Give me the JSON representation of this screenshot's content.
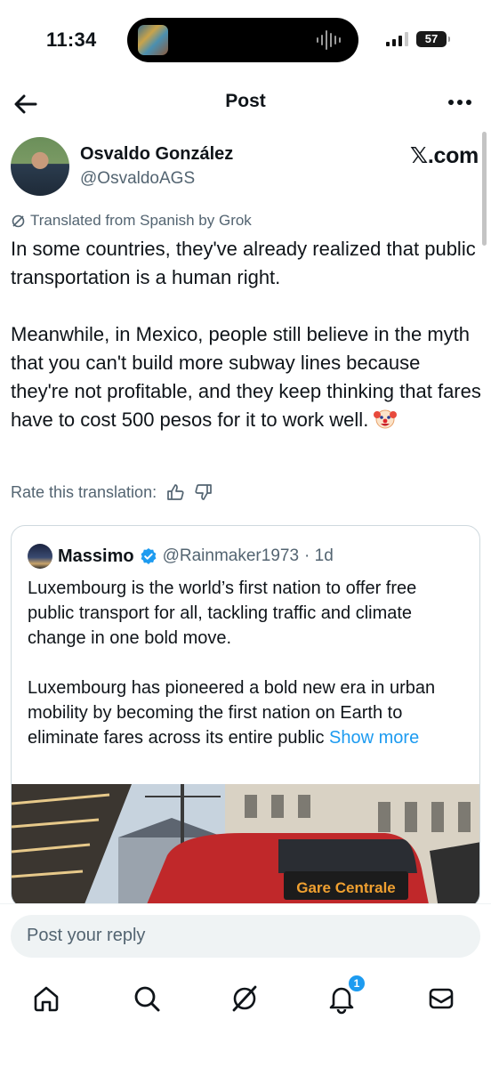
{
  "status": {
    "time": "11:34",
    "battery": "57"
  },
  "header": {
    "title": "Post"
  },
  "author": {
    "name": "Osvaldo González",
    "handle": "@OsvaldoAGS",
    "source_badge": "𝕏.com"
  },
  "translation_notice": "Translated from Spanish by Grok",
  "post": {
    "paragraph1": "In some countries, they've already realized that public transportation is a human right.",
    "paragraph2": "Meanwhile, in Mexico, people still believe in the myth that you can't build more subway lines because they're not profitable, and they keep thinking that fares have to cost 500 pesos for it to work well."
  },
  "rate_translation": {
    "label": "Rate this translation:"
  },
  "quote": {
    "name": "Massimo",
    "handle": "@Rainmaker1973",
    "age": "· 1d",
    "paragraph1": "Luxembourg is the world’s first nation to offer free public transport for all, tackling traffic and climate change in one bold move.",
    "paragraph2": "Luxembourg has pioneered a bold new era in urban mobility by becoming the first nation on Earth to eliminate fares across its entire public",
    "show_more": "Show more",
    "image_sign": "Gare Centrale"
  },
  "reply": {
    "placeholder": "Post your reply"
  },
  "tabbar": {
    "notifications_badge": "1"
  },
  "colors": {
    "accent": "#1d9bf0",
    "muted": "#536471",
    "text": "#0f1419",
    "tram_red": "#c0282a"
  }
}
